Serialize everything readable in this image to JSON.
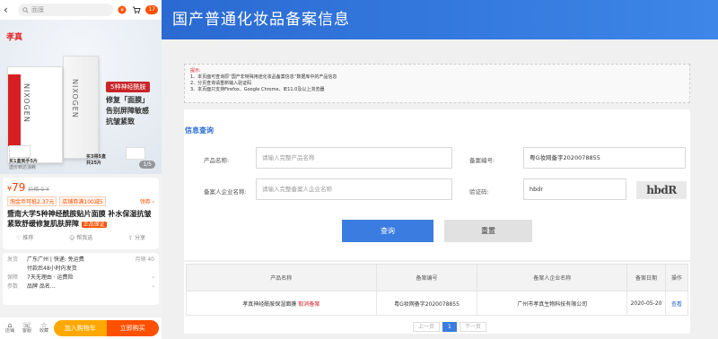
{
  "mobile": {
    "search_placeholder": "面膜",
    "cart_count": "17",
    "hero": {
      "brand": "孝真",
      "pill": "5种神经酰胺",
      "slogan": [
        "修复「面膜」",
        "告别屏障敏感",
        "抗皱紧致"
      ],
      "box_text": "NIXOGEN",
      "thumb1_caption": [
        "买1盒到手5片",
        "送价到达消耗"
      ],
      "thumb2_caption": [
        "买3得5盒",
        "共25片"
      ],
      "counter": "1/5"
    },
    "price": {
      "value": "79",
      "old": "价格 9 ¥",
      "tags": [
        "淘金币可抵2.37元",
        "店铺券满100减5"
      ],
      "tag_more": "领券 ›",
      "title": "暨南大学5种神经酰胺贴片面膜 补水保湿抗皱紧致舒缓修复肌肤屏障",
      "title_badge": "正品保证",
      "actions": [
        "推荐",
        "帮我选",
        "分享"
      ]
    },
    "info": {
      "rows": [
        {
          "label": "发货",
          "value": "广东广州 | 快递: 免运费",
          "extra": "月销 40"
        },
        {
          "label": "",
          "value": "付款后48小时内发货",
          "extra": ""
        },
        {
          "label": "保障",
          "value": "7天无理由 · 运费险",
          "extra": "›"
        },
        {
          "label": "参数",
          "value": "品牌 品名...",
          "extra": "›"
        }
      ]
    },
    "bottom": {
      "icons": [
        "店铺",
        "客服",
        "收藏"
      ],
      "add_cart": "加入购物车",
      "buy_now": "立即购买"
    }
  },
  "site": {
    "header_title": "国产普通化妆品备案信息",
    "notice": {
      "title": "提示:",
      "lines": [
        "1、本页面可查询原“国产非特殊用途化妆品备案信息”数据库中的产品信息",
        "2、分页查询请重新输入验证码",
        "3、本页面只支持Firefox、Google Chrome、IE11.0及以上浏览器"
      ]
    },
    "form": {
      "title": "信息查询",
      "product_name_label": "产品名称:",
      "product_name_placeholder": "请输入完整产品名称",
      "record_no_label": "备案编号:",
      "record_no_value": "粤G妆网备字2020078855",
      "company_label": "备案人企业名称:",
      "company_placeholder": "请输入完整备案人企业名称",
      "captcha_label": "验证码:",
      "captcha_value": "hbdr",
      "captcha_image": "hbdR",
      "query_button": "查询",
      "reset_button": "重置"
    },
    "table": {
      "headers": [
        "产品名称",
        "备案编号",
        "备案人企业名称",
        "备案日期",
        "操作"
      ],
      "rows": [
        {
          "name": "孝真神经酰胺保湿面膜",
          "status": "取消备案",
          "record_no": "粤G妆网备字2020078855",
          "company": "广州市孝真生物科技有限公司",
          "date": "2020-05-20",
          "op": "查看"
        }
      ]
    },
    "pager": {
      "prev": "上一页",
      "current": "1",
      "next": "下一页"
    }
  }
}
